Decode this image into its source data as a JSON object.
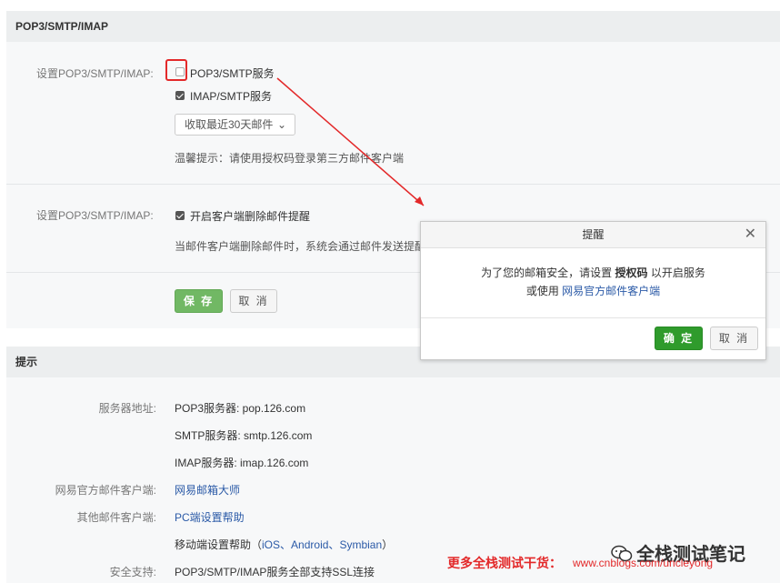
{
  "pop_section": {
    "header": "POP3/SMTP/IMAP",
    "row1_label": "设置POP3/SMTP/IMAP:",
    "pop_option": "POP3/SMTP服务",
    "pop_checked": false,
    "imap_option": "IMAP/SMTP服务",
    "imap_checked": true,
    "sync_select": "收取最近30天邮件",
    "tip": "温馨提示：请使用授权码登录第三方邮件客户端",
    "row2_label": "设置POP3/SMTP/IMAP:",
    "delete_option": "开启客户端删除邮件提醒",
    "delete_checked": true,
    "delete_desc": "当邮件客户端删除邮件时，系统会通过邮件发送提醒",
    "save_label": "保 存",
    "cancel_label": "取 消"
  },
  "tips_section": {
    "header": "提示",
    "server_label": "服务器地址:",
    "pop3": "POP3服务器: pop.126.com",
    "smtp": "SMTP服务器: smtp.126.com",
    "imap": "IMAP服务器: imap.126.com",
    "official_label": "网易官方邮件客户端:",
    "official_link": "网易邮箱大师",
    "other_label": "其他邮件客户端:",
    "pc_link": "PC端设置帮助",
    "mobile_prefix": "移动端设置帮助（",
    "ios": "iOS",
    "sep1": "、",
    "android": "Android",
    "sep2": "、",
    "symbian": "Symbian",
    "mobile_suffix": "）",
    "security_label": "安全支持:",
    "security_value": "POP3/SMTP/IMAP服务全部支持SSL连接"
  },
  "dialog": {
    "title": "提醒",
    "line1_prefix": "为了您的邮箱安全，请设置",
    "line1_bold": "授权码",
    "line1_suffix": "以开启服务",
    "line2_prefix": "或使用",
    "line2_link": "网易官方邮件客户端",
    "ok_label": "确 定",
    "cancel_label": "取 消"
  },
  "watermark": {
    "promo": "更多全栈测试干货：",
    "url": "www.cnblogs.com/uncleyong",
    "brand": "全栈测试笔记"
  },
  "colors": {
    "annotation_red": "#e3292a",
    "link_blue": "#2b5aa7",
    "save_green": "#71b864",
    "ok_green": "#2f9b2c"
  }
}
